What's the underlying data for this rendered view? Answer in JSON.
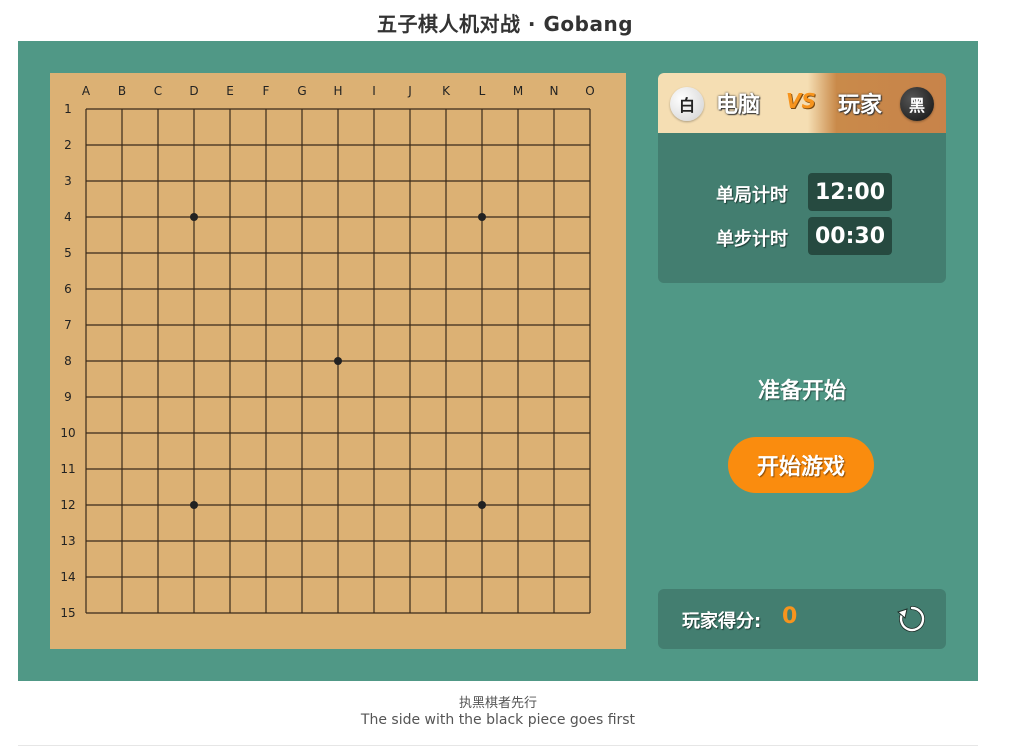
{
  "page": {
    "title": "五子棋人机对战 · Gobang"
  },
  "board": {
    "columns": [
      "A",
      "B",
      "C",
      "D",
      "E",
      "F",
      "G",
      "H",
      "I",
      "J",
      "K",
      "L",
      "M",
      "N",
      "O"
    ],
    "rows": [
      "1",
      "2",
      "3",
      "4",
      "5",
      "6",
      "7",
      "8",
      "9",
      "10",
      "11",
      "12",
      "13",
      "14",
      "15"
    ],
    "star_points": [
      {
        "col": "D",
        "row": 4
      },
      {
        "col": "L",
        "row": 4
      },
      {
        "col": "H",
        "row": 8
      },
      {
        "col": "D",
        "row": 12
      },
      {
        "col": "L",
        "row": 12
      }
    ],
    "colors": {
      "board": "#dcb174",
      "lines": "#3a2a1a"
    }
  },
  "players": {
    "computer": {
      "stone": "白",
      "name": "电脑"
    },
    "vs": "VS",
    "human": {
      "stone": "黑",
      "name": "玩家"
    }
  },
  "timers": {
    "total_label": "单局计时",
    "total_value": "12:00",
    "step_label": "单步计时",
    "step_value": "00:30"
  },
  "status": "准备开始",
  "start_button": "开始游戏",
  "score": {
    "label": "玩家得分:",
    "value": "0",
    "restart_icon": "restart-icon"
  },
  "footer": {
    "cn": "执黑棋者先行",
    "en": "The side with the black piece goes first"
  },
  "theme": {
    "background": "#509886",
    "panel": "#437e70",
    "accent": "#fa8c0e"
  }
}
